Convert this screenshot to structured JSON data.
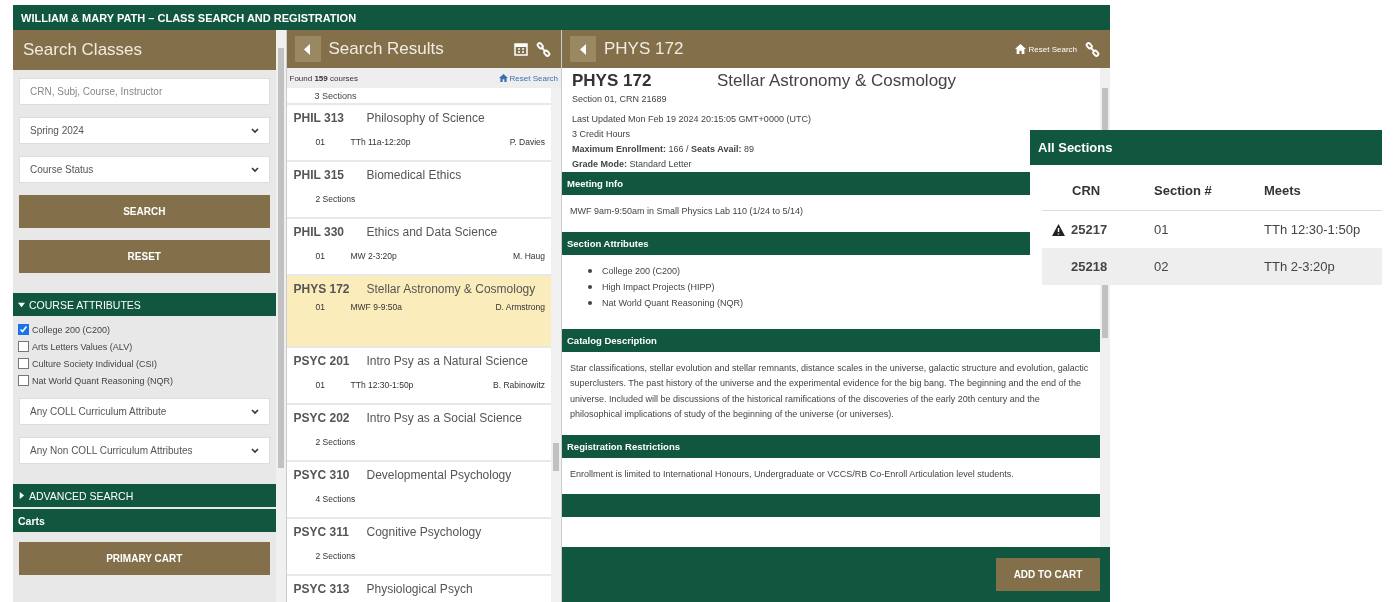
{
  "app_title": "WILLIAM & MARY PATH – CLASS SEARCH AND REGISTRATION",
  "search_panel": {
    "title": "Search Classes",
    "keyword_field": {
      "placeholder": "CRN, Subj, Course, Instructor"
    },
    "term_select": {
      "value": "Spring 2024"
    },
    "status_select": {
      "value": "Course Status"
    },
    "buttons": [
      "SEARCH",
      "RESET"
    ],
    "attributes_section": {
      "label": "COURSE ATTRIBUTES",
      "expanded": true
    },
    "attributes": [
      {
        "label": "College 200 (C200)",
        "checked": true
      },
      {
        "label": "Arts Letters Values (ALV)",
        "checked": false
      },
      {
        "label": "Culture Society Individual (CSI)",
        "checked": false
      },
      {
        "label": "Nat World Quant Reasoning (NQR)",
        "checked": false
      }
    ],
    "coll_select": {
      "value": "Any COLL Curriculum Attribute"
    },
    "noncoll_select": {
      "value": "Any Non COLL Curriculum Attributes"
    },
    "advanced_section": {
      "label": "ADVANCED SEARCH",
      "expanded": false
    },
    "carts_label": "Carts",
    "cart_button": "PRIMARY CART"
  },
  "results_panel": {
    "title": "Search Results",
    "found_text": "Found **159** courses",
    "reset_link": "Reset Search",
    "partial_row": "3 Sections",
    "courses": [
      {
        "code": "PHIL 313",
        "title": "Philosophy of Science",
        "selected": false,
        "kind": "single",
        "section": "01",
        "time": "TTh 11a-12:20p",
        "instructor": "P. Davies"
      },
      {
        "code": "PHIL 315",
        "title": "Biomedical Ethics",
        "selected": false,
        "kind": "multi",
        "sections": "2 Sections"
      },
      {
        "code": "PHIL 330",
        "title": "Ethics and Data Science",
        "selected": false,
        "kind": "single",
        "section": "01",
        "time": "MW 2-3:20p",
        "instructor": "M. Haug"
      },
      {
        "code": "PHYS 172",
        "title": "Stellar Astronomy & Cosmology",
        "selected": true,
        "kind": "single",
        "section": "01",
        "time": "MWF 9-9:50a",
        "instructor": "D. Armstrong"
      },
      {
        "code": "PSYC 201",
        "title": "Intro Psy as a Natural Science",
        "selected": false,
        "kind": "single",
        "section": "01",
        "time": "TTh 12:30-1:50p",
        "instructor": "B. Rabinowitz"
      },
      {
        "code": "PSYC 202",
        "title": "Intro Psy as a Social Science",
        "selected": false,
        "kind": "multi",
        "sections": "2 Sections"
      },
      {
        "code": "PSYC 310",
        "title": "Developmental Psychology",
        "selected": false,
        "kind": "multi",
        "sections": "4 Sections"
      },
      {
        "code": "PSYC 311",
        "title": "Cognitive Psychology",
        "selected": false,
        "kind": "multi",
        "sections": "2 Sections"
      },
      {
        "code": "PSYC 313",
        "title": "Physiological Psych",
        "selected": false,
        "kind": "multi"
      }
    ]
  },
  "detail_panel": {
    "title": "PHYS 172",
    "reset_link": "Reset Search",
    "code": "PHYS 172",
    "name": "Stellar Astronomy & Cosmology",
    "section_line": "Section 01, CRN 21689",
    "facts": [
      "Last Updated Mon Feb 19 2024 20:15:05 GMT+0000 (UTC)",
      "3 Credit Hours",
      "**Maximum Enrollment:** 166 / **Seats Avail:** 89",
      "**Grade Mode:** Standard Letter"
    ],
    "sections": [
      {
        "kind": "text",
        "heading": "Meeting Info",
        "text": "MWF 9am-9:50am in Small Physics Lab 110 (1/24 to 5/14)"
      },
      {
        "kind": "list",
        "heading": "Section Attributes",
        "items": [
          "College 200 (C200)",
          "High Impact Projects (HIPP)",
          "Nat World Quant Reasoning (NQR)"
        ]
      },
      {
        "kind": "text",
        "heading": "Catalog Description",
        "text": "Star classifications, stellar evolution and stellar remnants, distance scales in the universe, galactic structure and evolution, galactic superclusters. The past history of the universe and the experimental evidence for the big bang. The beginning and the end of the universe. Included will be discussions of the historical ramifications of the discoveries of the early 20th century and the philosophical implications of study of the beginning of the universe (or universes)."
      },
      {
        "kind": "text",
        "heading": "Registration Restrictions",
        "text": "Enrollment is limited to International Honours, Undergraduate or VCCS/RB Co-Enroll Articulation level students."
      }
    ],
    "add_button": "ADD TO CART"
  },
  "all_sections": {
    "title": "All Sections",
    "columns": [
      "CRN",
      "Section #",
      "Meets"
    ],
    "rows": [
      {
        "crn": "25217",
        "section": "01",
        "meets": "TTh 12:30-1:50p",
        "warning": true
      },
      {
        "crn": "25218",
        "section": "02",
        "meets": "TTh 2-3:20p",
        "warning": false
      }
    ]
  }
}
